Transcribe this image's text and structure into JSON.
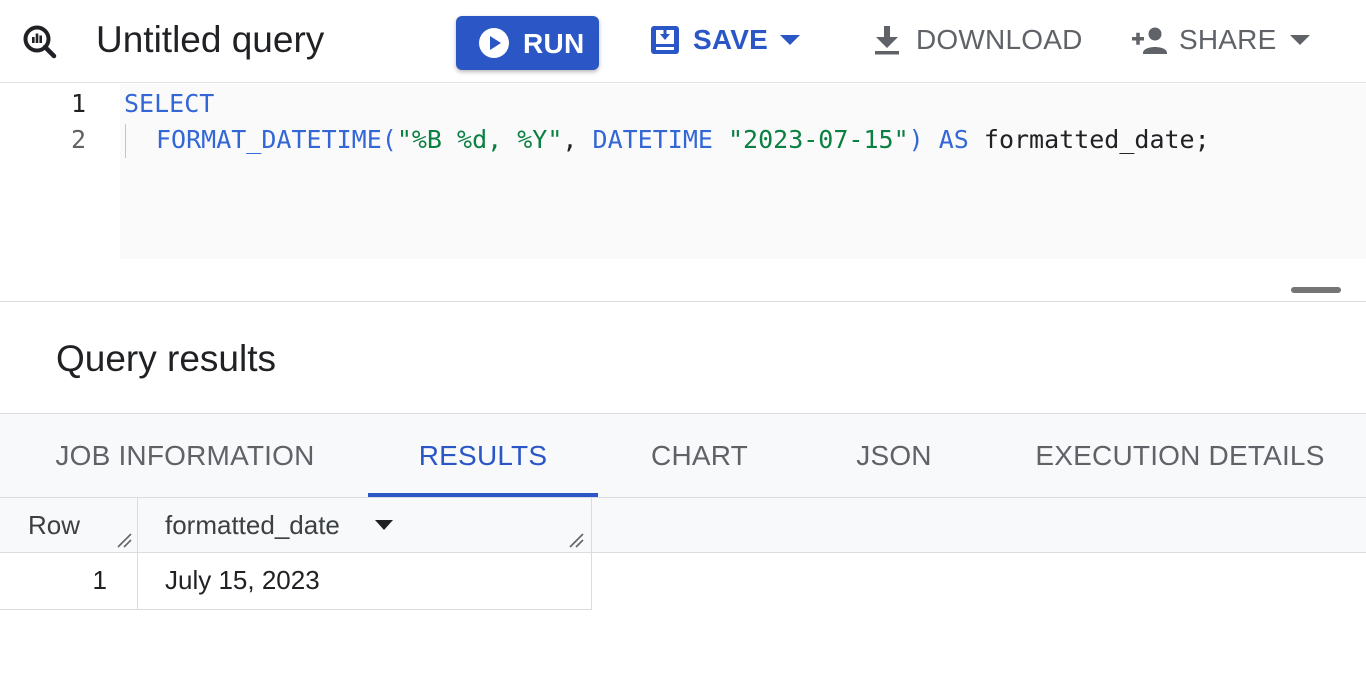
{
  "toolbar": {
    "title": "Untitled query",
    "run_label": "RUN",
    "save_label": "SAVE",
    "download_label": "DOWNLOAD",
    "share_label": "SHARE",
    "icons": {
      "query": "query-magnifier-icon",
      "run": "play-circle-icon",
      "save": "save-icon",
      "download": "download-icon",
      "share": "person-add-icon",
      "dropdown": "caret-down-icon"
    }
  },
  "editor": {
    "line_numbers": [
      "1",
      "2"
    ],
    "line1": {
      "keyword": "SELECT"
    },
    "line2": {
      "func": "FORMAT_DATETIME(",
      "fmt": "\"%B %d, %Y\"",
      "sep": ", ",
      "kw_datetime": "DATETIME",
      "space": " ",
      "date_lit": "\"2023-07-15\"",
      "close": ") ",
      "kw_as": "AS",
      "alias": " formatted_date;"
    }
  },
  "results": {
    "title": "Query results",
    "tabs": [
      {
        "label": "JOB INFORMATION",
        "active": false
      },
      {
        "label": "RESULTS",
        "active": true
      },
      {
        "label": "CHART",
        "active": false
      },
      {
        "label": "JSON",
        "active": false
      },
      {
        "label": "EXECUTION DETAILS",
        "active": false
      }
    ],
    "table": {
      "columns": [
        "Row",
        "formatted_date"
      ],
      "rows": [
        {
          "row": "1",
          "formatted_date": "July 15, 2023"
        }
      ]
    }
  },
  "colors": {
    "accent": "#2a56c6",
    "keyword": "#3367d6",
    "string": "#0b8043",
    "muted_text": "#5f6368"
  }
}
